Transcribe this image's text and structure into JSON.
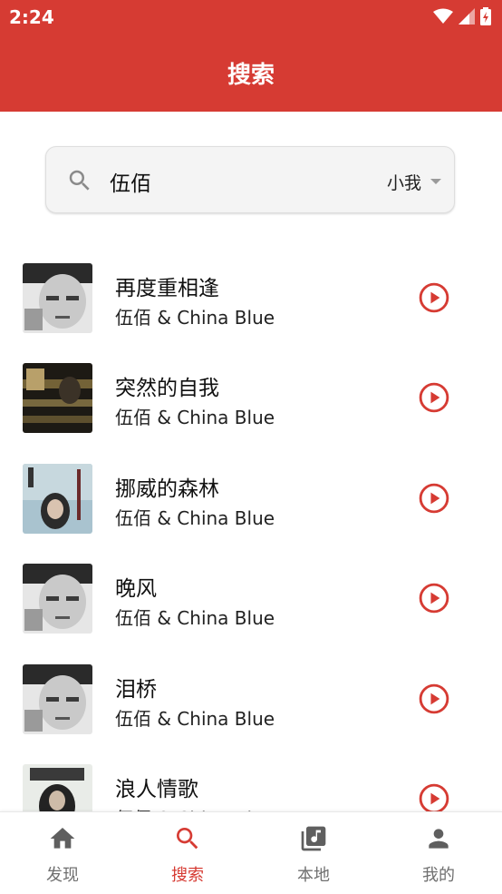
{
  "status_bar": {
    "time": "2:24"
  },
  "app_bar": {
    "title": "搜索"
  },
  "search": {
    "query": "伍佰",
    "source_label": "小我"
  },
  "songs": [
    {
      "title": "再度重相逢",
      "artist": "伍佰 & China Blue"
    },
    {
      "title": "突然的自我",
      "artist": "伍佰 & China Blue"
    },
    {
      "title": "挪威的森林",
      "artist": "伍佰 & China Blue"
    },
    {
      "title": "晚风",
      "artist": "伍佰 & China Blue"
    },
    {
      "title": "泪桥",
      "artist": "伍佰 & China Blue"
    },
    {
      "title": "浪人情歌",
      "artist": "伍佰 & China Blue"
    }
  ],
  "nav": {
    "items": [
      {
        "label": "发现",
        "icon": "home-icon"
      },
      {
        "label": "搜索",
        "icon": "search-icon",
        "active": true
      },
      {
        "label": "本地",
        "icon": "music-library-icon"
      },
      {
        "label": "我的",
        "icon": "person-icon"
      }
    ]
  },
  "colors": {
    "accent": "#d63b33",
    "inactive": "#6f6f6f",
    "inactive_icon": "#5f5f5f"
  }
}
